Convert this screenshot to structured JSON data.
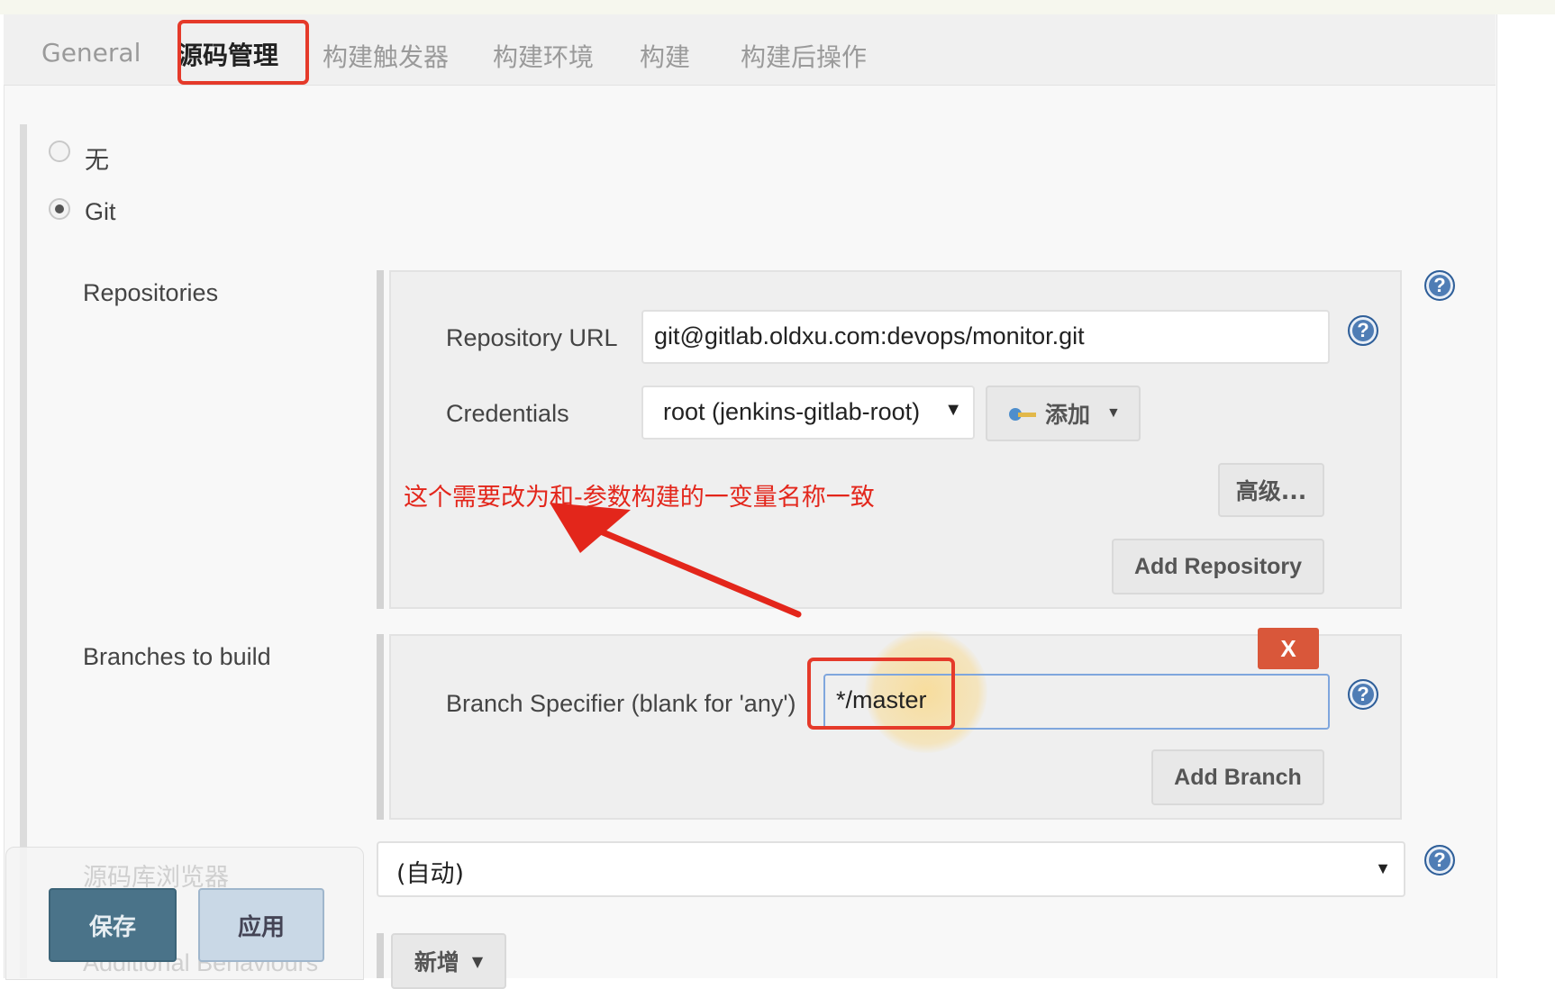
{
  "tabs": {
    "general": "General",
    "source_control": "源码管理",
    "build_triggers": "构建触发器",
    "build_env": "构建环境",
    "build": "构建",
    "post_build": "构建后操作"
  },
  "scm": {
    "option_none": "无",
    "option_git": "Git",
    "selected": "Git"
  },
  "repositories": {
    "section_label": "Repositories",
    "url_label": "Repository URL",
    "url_value": "git@gitlab.oldxu.com:devops/monitor.git",
    "credentials_label": "Credentials",
    "credentials_value": "root (jenkins-gitlab-root)",
    "add_credentials_label": "添加",
    "advanced_label": "高级...",
    "add_repository_label": "Add Repository"
  },
  "annotation": {
    "text": "这个需要改为和-参数构建的一变量名称一致"
  },
  "branches": {
    "section_label": "Branches to build",
    "specifier_label": "Branch Specifier (blank for 'any')",
    "specifier_value": "*/master",
    "delete_label": "X",
    "add_branch_label": "Add Branch"
  },
  "repo_browser": {
    "label": "源码库浏览器",
    "value": "(自动)"
  },
  "behaviours": {
    "label": "Additional Behaviours",
    "add_label": "新增"
  },
  "actions": {
    "save": "保存",
    "apply": "应用"
  },
  "help_glyph": "?",
  "colors": {
    "annotation_red": "#e3261b",
    "save_button": "#4a7389",
    "delete_button": "#d9573a",
    "help_icon": "#4f7db5"
  }
}
